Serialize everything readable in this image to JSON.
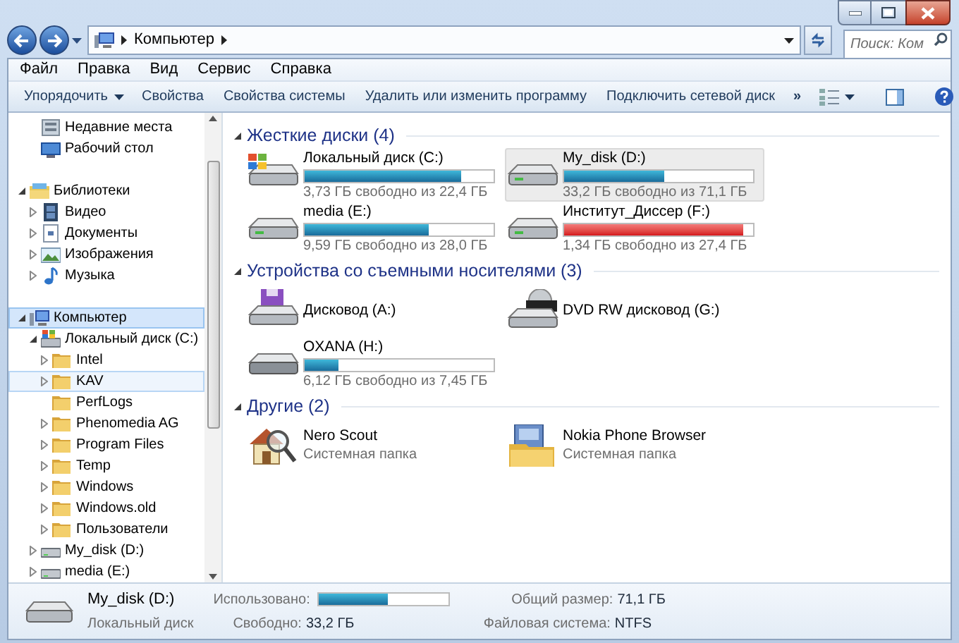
{
  "address": {
    "crumbs": [
      "Компьютер"
    ],
    "search_placeholder": "Поиск: Ком"
  },
  "menu": [
    "Файл",
    "Правка",
    "Вид",
    "Сервис",
    "Справка"
  ],
  "toolbar": [
    {
      "label": "Упорядочить",
      "kind": "dropdown"
    },
    {
      "label": "Свойства",
      "kind": "button"
    },
    {
      "label": "Свойства системы",
      "kind": "button"
    },
    {
      "label": "Удалить или изменить программу",
      "kind": "button"
    },
    {
      "label": "Подключить сетевой диск",
      "kind": "button"
    },
    {
      "label": "»",
      "kind": "more"
    }
  ],
  "sidebar": {
    "favorites": [
      {
        "label": "Недавние места",
        "kind": "recent",
        "expandable": false,
        "selected": false,
        "hot": false
      },
      {
        "label": "Рабочий стол",
        "kind": "desktop",
        "expandable": false,
        "selected": false,
        "hot": false
      }
    ],
    "trees": [
      {
        "label": "Библиотеки",
        "kind": "library",
        "expandable": true,
        "expanded": true,
        "selected": false,
        "hot": false,
        "children": [
          {
            "label": "Видео",
            "kind": "video",
            "expandable": true,
            "expanded": false,
            "selected": false,
            "hot": false
          },
          {
            "label": "Документы",
            "kind": "docs",
            "expandable": true,
            "expanded": false,
            "selected": false,
            "hot": false
          },
          {
            "label": "Изображения",
            "kind": "images",
            "expandable": true,
            "expanded": false,
            "selected": false,
            "hot": false
          },
          {
            "label": "Музыка",
            "kind": "music",
            "expandable": true,
            "expanded": false,
            "selected": false,
            "hot": false
          }
        ]
      },
      {
        "label": "Компьютер",
        "kind": "computer",
        "expandable": true,
        "expanded": true,
        "selected": true,
        "hot": false,
        "children": [
          {
            "label": "Локальный диск (C:)",
            "kind": "osdrive",
            "expandable": true,
            "expanded": true,
            "selected": false,
            "hot": false,
            "children": [
              {
                "label": "Intel",
                "kind": "folder",
                "expandable": true,
                "expanded": false,
                "selected": false,
                "hot": false
              },
              {
                "label": "KAV",
                "kind": "folder",
                "expandable": true,
                "expanded": false,
                "selected": false,
                "hot": true
              },
              {
                "label": "PerfLogs",
                "kind": "folder",
                "expandable": false,
                "selected": false,
                "hot": false
              },
              {
                "label": "Phenomedia AG",
                "kind": "folder",
                "expandable": true,
                "expanded": false,
                "selected": false,
                "hot": false
              },
              {
                "label": "Program Files",
                "kind": "folder",
                "expandable": true,
                "expanded": false,
                "selected": false,
                "hot": false
              },
              {
                "label": "Temp",
                "kind": "folder",
                "expandable": true,
                "expanded": false,
                "selected": false,
                "hot": false
              },
              {
                "label": "Windows",
                "kind": "folder",
                "expandable": true,
                "expanded": false,
                "selected": false,
                "hot": false
              },
              {
                "label": "Windows.old",
                "kind": "folder",
                "expandable": true,
                "expanded": false,
                "selected": false,
                "hot": false
              },
              {
                "label": "Пользователи",
                "kind": "folder",
                "expandable": true,
                "expanded": false,
                "selected": false,
                "hot": false
              }
            ]
          },
          {
            "label": "My_disk (D:)",
            "kind": "drive",
            "expandable": true,
            "expanded": false,
            "selected": false,
            "hot": false
          },
          {
            "label": "media (E:)",
            "kind": "drive",
            "expandable": true,
            "expanded": false,
            "selected": false,
            "hot": false
          }
        ]
      }
    ]
  },
  "groups": [
    {
      "title": "Жесткие диски (4)",
      "items": [
        {
          "name": "Локальный диск (C:)",
          "kind": "osdrive",
          "level": 0.83,
          "free": "3,73 ГБ свободно из 22,4 ГБ",
          "warning": false,
          "selected": false
        },
        {
          "name": "My_disk (D:)",
          "kind": "drive",
          "level": 0.53,
          "free": "33,2 ГБ свободно из 71,1 ГБ",
          "warning": false,
          "selected": true
        },
        {
          "name": "media (E:)",
          "kind": "drive",
          "level": 0.66,
          "free": "9,59 ГБ свободно из 28,0 ГБ",
          "warning": false,
          "selected": false
        },
        {
          "name": "Институт_Диссер (F:)",
          "kind": "drive",
          "level": 0.95,
          "free": "1,34 ГБ свободно из 27,4 ГБ",
          "warning": true,
          "selected": false
        }
      ]
    },
    {
      "title": "Устройства со съемными носителями (3)",
      "items": [
        {
          "name": "Дисковод (A:)",
          "kind": "floppy",
          "selected": false
        },
        {
          "name": "DVD RW дисковод (G:)",
          "kind": "dvd",
          "selected": false
        },
        {
          "name": "OXANA (H:)",
          "kind": "usb",
          "level": 0.18,
          "free": "6,12 ГБ свободно из 7,45 ГБ",
          "warning": false,
          "selected": false
        }
      ]
    },
    {
      "title": "Другие (2)",
      "items": [
        {
          "name": "Nero Scout",
          "kind": "house",
          "subtitle": "Системная папка",
          "selected": false
        },
        {
          "name": "Nokia Phone Browser",
          "kind": "phonefolder",
          "subtitle": "Системная папка",
          "selected": false
        }
      ]
    }
  ],
  "details": {
    "name": "My_disk (D:)",
    "type": "Локальный диск",
    "used_label": "Использовано:",
    "level": 0.53,
    "free_label": "Свободно:",
    "free_value": "33,2 ГБ",
    "size_label": "Общий размер:",
    "size_value": "71,1 ГБ",
    "fs_label": "Файловая система:",
    "fs_value": "NTFS"
  }
}
